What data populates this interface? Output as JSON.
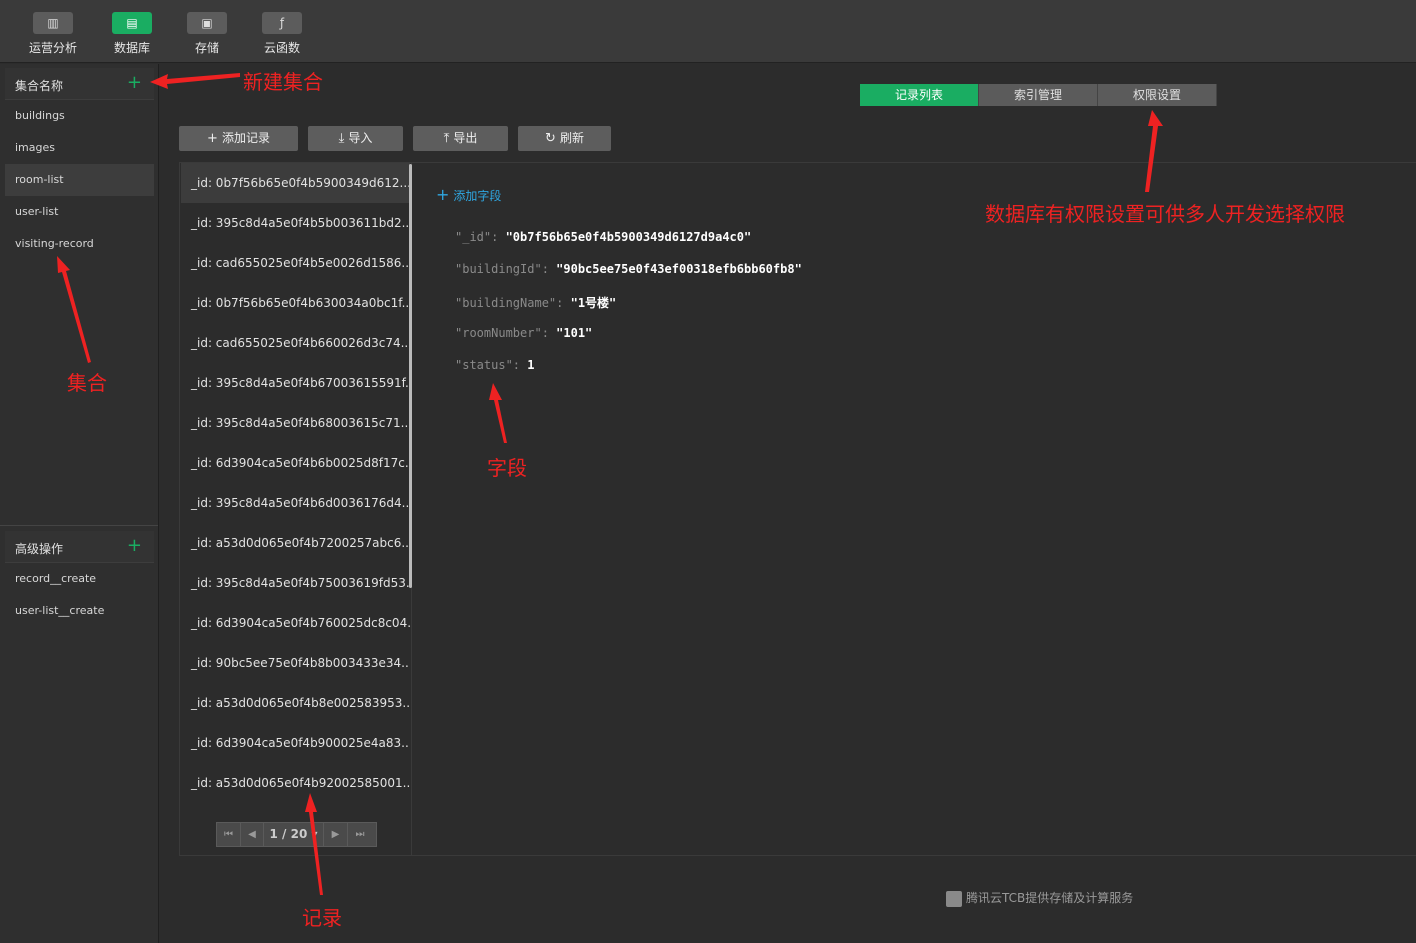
{
  "toolbar": {
    "items": [
      {
        "label": "运营分析",
        "icon": "bar-chart-icon"
      },
      {
        "label": "数据库",
        "icon": "database-icon"
      },
      {
        "label": "存储",
        "icon": "save-icon"
      },
      {
        "label": "云函数",
        "icon": "function-icon"
      }
    ],
    "active_index": 1
  },
  "sidebar": {
    "collections_title": "集合名称",
    "collections": [
      "buildings",
      "images",
      "room-list",
      "user-list",
      "visiting-record"
    ],
    "selected_collection": "room-list",
    "advanced_title": "高级操作",
    "advanced": [
      "record__create",
      "user-list__create"
    ]
  },
  "tabs": [
    "记录列表",
    "索引管理",
    "权限设置"
  ],
  "actions": {
    "add_record": "添加记录",
    "import": "导入",
    "export": "导出",
    "refresh": "刷新"
  },
  "records": [
    "_id: 0b7f56b65e0f4b5900349d612...",
    "_id: 395c8d4a5e0f4b5b003611bd2...",
    "_id: cad655025e0f4b5e0026d1586...",
    "_id: 0b7f56b65e0f4b630034a0bc1f...",
    "_id: cad655025e0f4b660026d3c74...",
    "_id: 395c8d4a5e0f4b67003615591f...",
    "_id: 395c8d4a5e0f4b68003615c71...",
    "_id: 6d3904ca5e0f4b6b0025d8f17c...",
    "_id: 395c8d4a5e0f4b6d0036176d4...",
    "_id: a53d0d065e0f4b7200257abc6...",
    "_id: 395c8d4a5e0f4b75003619fd53...",
    "_id: 6d3904ca5e0f4b760025dc8c04...",
    "_id: 90bc5ee75e0f4b8b003433e34...",
    "_id: a53d0d065e0f4b8e002583953...",
    "_id: 6d3904ca5e0f4b900025e4a83...",
    "_id: a53d0d065e0f4b92002585001..."
  ],
  "pager": {
    "label": "1 / 20"
  },
  "add_field_label": "添加字段",
  "document_fields": [
    {
      "key": "\"_id\"",
      "value": "\"0b7f56b65e0f4b5900349d6127d9a4c0\""
    },
    {
      "key": "\"buildingId\"",
      "value": "\"90bc5ee75e0f43ef00318efb6bb60fb8\""
    },
    {
      "key": "\"buildingName\"",
      "value": "\"1号楼\""
    },
    {
      "key": "\"roomNumber\"",
      "value": "\"101\""
    },
    {
      "key": "\"status\"",
      "value": "1"
    }
  ],
  "footer": "腾讯云TCB提供存储及计算服务",
  "annotations": {
    "new_collection": "新建集合",
    "collection": "集合",
    "permissions": "数据库有权限设置可供多人开发选择权限",
    "field": "字段",
    "record": "记录"
  },
  "colors": {
    "accent": "#1aad62",
    "link": "#2fa6e0",
    "annotation": "#ee2222"
  }
}
